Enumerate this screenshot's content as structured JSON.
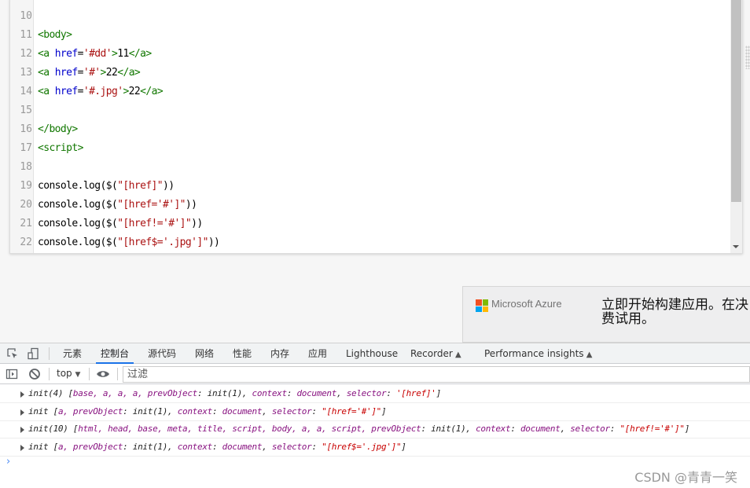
{
  "editor": {
    "lines": [
      {
        "n": "10",
        "segs": []
      },
      {
        "n": "11",
        "segs": [
          {
            "c": "tag",
            "t": "<body>"
          }
        ]
      },
      {
        "n": "12",
        "segs": [
          {
            "c": "tag",
            "t": "<a "
          },
          {
            "c": "attr",
            "t": "href"
          },
          {
            "c": "plain",
            "t": "="
          },
          {
            "c": "str",
            "t": "'#dd'"
          },
          {
            "c": "tag",
            "t": ">"
          },
          {
            "c": "plain",
            "t": "11"
          },
          {
            "c": "tag",
            "t": "</a>"
          }
        ]
      },
      {
        "n": "13",
        "segs": [
          {
            "c": "tag",
            "t": "<a "
          },
          {
            "c": "attr",
            "t": "href"
          },
          {
            "c": "plain",
            "t": "="
          },
          {
            "c": "str",
            "t": "'#'"
          },
          {
            "c": "tag",
            "t": ">"
          },
          {
            "c": "plain",
            "t": "22"
          },
          {
            "c": "tag",
            "t": "</a>"
          }
        ]
      },
      {
        "n": "14",
        "segs": [
          {
            "c": "tag",
            "t": "<a "
          },
          {
            "c": "attr",
            "t": "href"
          },
          {
            "c": "plain",
            "t": "="
          },
          {
            "c": "str",
            "t": "'#.jpg'"
          },
          {
            "c": "tag",
            "t": ">"
          },
          {
            "c": "plain",
            "t": "22"
          },
          {
            "c": "tag",
            "t": "</a>"
          }
        ]
      },
      {
        "n": "15",
        "segs": []
      },
      {
        "n": "16",
        "segs": [
          {
            "c": "tag",
            "t": "</body>"
          }
        ]
      },
      {
        "n": "17",
        "segs": [
          {
            "c": "tag",
            "t": "<script>"
          }
        ]
      },
      {
        "n": "18",
        "segs": []
      },
      {
        "n": "19",
        "segs": [
          {
            "c": "plain",
            "t": "console.log($("
          },
          {
            "c": "str",
            "t": "\"[href]\""
          },
          {
            "c": "plain",
            "t": "))"
          }
        ]
      },
      {
        "n": "20",
        "segs": [
          {
            "c": "plain",
            "t": "console.log($("
          },
          {
            "c": "str",
            "t": "\"[href='#']\""
          },
          {
            "c": "plain",
            "t": "))"
          }
        ]
      },
      {
        "n": "21",
        "segs": [
          {
            "c": "plain",
            "t": "console.log($("
          },
          {
            "c": "str",
            "t": "\"[href!='#']\""
          },
          {
            "c": "plain",
            "t": "))"
          }
        ]
      },
      {
        "n": "22",
        "segs": [
          {
            "c": "plain",
            "t": "console.log($("
          },
          {
            "c": "str",
            "t": "\"[href$='.jpg']\""
          },
          {
            "c": "plain",
            "t": "))"
          }
        ]
      }
    ]
  },
  "ad": {
    "brand": "Microsoft Azure",
    "text_line1": "立即开始构建应用。在决",
    "text_line2": "费试用。",
    "logo_colors": [
      "#f25022",
      "#7fba00",
      "#00a4ef",
      "#ffb900"
    ]
  },
  "devtools": {
    "tabs": [
      {
        "label": "元素"
      },
      {
        "label": "控制台",
        "active": true
      },
      {
        "label": "源代码"
      },
      {
        "label": "网络"
      },
      {
        "label": "性能"
      },
      {
        "label": "内存"
      },
      {
        "label": "应用"
      },
      {
        "label": "Lighthouse"
      },
      {
        "label": "Recorder",
        "flask": true
      },
      {
        "label": "Performance insights",
        "flask": true
      }
    ],
    "context": "top",
    "filter_placeholder": "过滤",
    "accent": "#1a73e8",
    "console_rows": [
      [
        {
          "c": "p",
          "t": "init(4) ["
        },
        {
          "c": "k",
          "t": "base, a, a, a, prevObject"
        },
        {
          "c": "p",
          "t": ": init(1), "
        },
        {
          "c": "k",
          "t": "context"
        },
        {
          "c": "p",
          "t": ": "
        },
        {
          "c": "k",
          "t": "document"
        },
        {
          "c": "p",
          "t": ", "
        },
        {
          "c": "k",
          "t": "selector"
        },
        {
          "c": "p",
          "t": ": "
        },
        {
          "c": "s",
          "t": "'[href]'"
        },
        {
          "c": "p",
          "t": "]"
        }
      ],
      [
        {
          "c": "p",
          "t": "init ["
        },
        {
          "c": "k",
          "t": "a, prevObject"
        },
        {
          "c": "p",
          "t": ": init(1), "
        },
        {
          "c": "k",
          "t": "context"
        },
        {
          "c": "p",
          "t": ": "
        },
        {
          "c": "k",
          "t": "document"
        },
        {
          "c": "p",
          "t": ", "
        },
        {
          "c": "k",
          "t": "selector"
        },
        {
          "c": "p",
          "t": ": "
        },
        {
          "c": "s",
          "t": "\"[href='#']\""
        },
        {
          "c": "p",
          "t": "]"
        }
      ],
      [
        {
          "c": "p",
          "t": "init(10) ["
        },
        {
          "c": "k",
          "t": "html, head, base, meta, title, script, body, a, a, script, prevObject"
        },
        {
          "c": "p",
          "t": ": init(1), "
        },
        {
          "c": "k",
          "t": "context"
        },
        {
          "c": "p",
          "t": ": "
        },
        {
          "c": "k",
          "t": "document"
        },
        {
          "c": "p",
          "t": ", "
        },
        {
          "c": "k",
          "t": "selector"
        },
        {
          "c": "p",
          "t": ": "
        },
        {
          "c": "s",
          "t": "\"[href!='#']\""
        },
        {
          "c": "p",
          "t": "]"
        }
      ],
      [
        {
          "c": "p",
          "t": "init ["
        },
        {
          "c": "k",
          "t": "a, prevObject"
        },
        {
          "c": "p",
          "t": ": init(1), "
        },
        {
          "c": "k",
          "t": "context"
        },
        {
          "c": "p",
          "t": ": "
        },
        {
          "c": "k",
          "t": "document"
        },
        {
          "c": "p",
          "t": ", "
        },
        {
          "c": "k",
          "t": "selector"
        },
        {
          "c": "p",
          "t": ": "
        },
        {
          "c": "s",
          "t": "\"[href$='.jpg']\""
        },
        {
          "c": "p",
          "t": "]"
        }
      ]
    ],
    "prompt": "›"
  },
  "watermark": "CSDN @青青一笑"
}
